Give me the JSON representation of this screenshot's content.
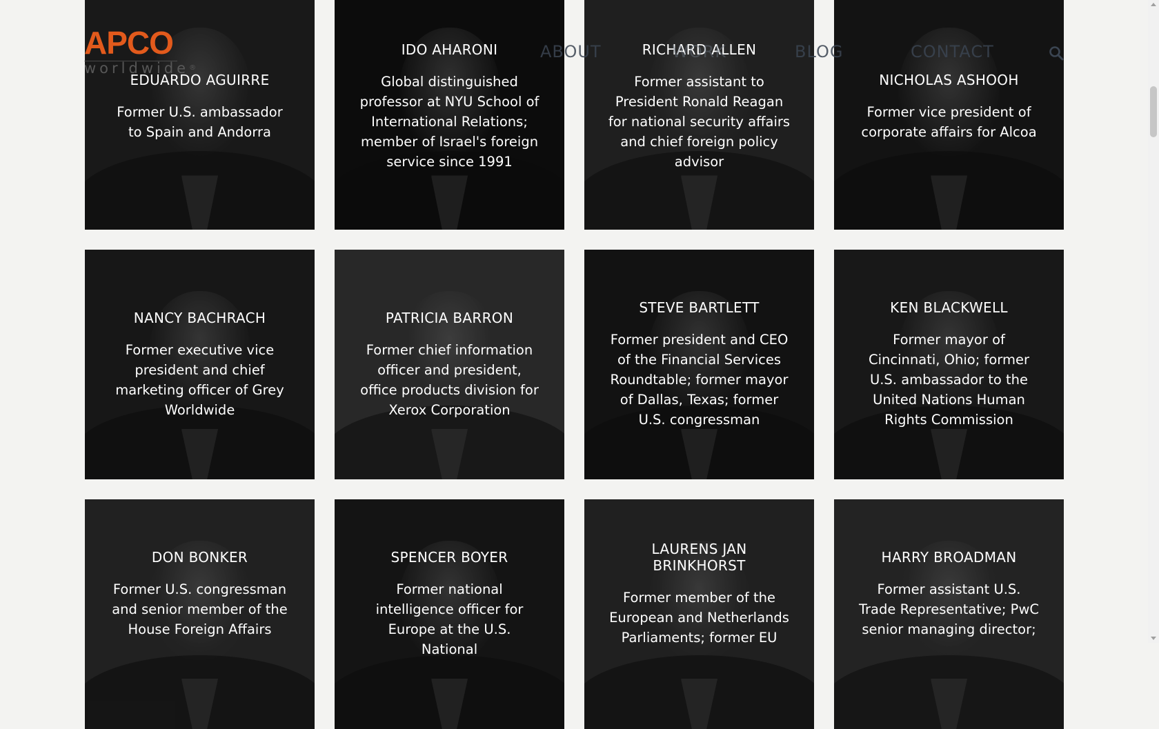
{
  "header": {
    "logo_text": "APCO",
    "logo_sub": "worldwide",
    "logo_reg": "®",
    "nav": [
      "ABOUT",
      "WORK",
      "RICHARD ALLEN",
      "BLOG",
      "CONTACT"
    ],
    "search_icon": "search-icon",
    "brand_color": "#e25a1c"
  },
  "people": [
    {
      "name": "EDUARDO AGUIRRE",
      "desc": "Former U.S. ambassador to Spain and Andorra"
    },
    {
      "name": "IDO AHARONI",
      "desc": "Global distinguished professor at NYU School of International Relations; member of Israel's foreign service since 1991"
    },
    {
      "name": "RICHARD ALLEN",
      "desc": "Former assistant to President Ronald Reagan for national security affairs and chief foreign policy advisor"
    },
    {
      "name": "NICHOLAS ASHOOH",
      "desc": "Former vice president of corporate affairs for Alcoa"
    },
    {
      "name": "NANCY BACHRACH",
      "desc": "Former executive vice president and chief marketing officer of Grey Worldwide"
    },
    {
      "name": "PATRICIA BARRON",
      "desc": "Former chief information officer and president, office products division for Xerox Corporation"
    },
    {
      "name": "STEVE BARTLETT",
      "desc": "Former president and CEO of the Financial Services Roundtable; former mayor of Dallas, Texas; former U.S. congressman"
    },
    {
      "name": "KEN BLACKWELL",
      "desc": "Former mayor of Cincinnati, Ohio; former U.S. ambassador to the United Nations Human Rights Commission"
    },
    {
      "name": "DON BONKER",
      "desc": "Former U.S. congressman and senior member of the House Foreign Affairs"
    },
    {
      "name": "SPENCER BOYER",
      "desc": "Former national intelligence officer for Europe at the U.S. National"
    },
    {
      "name": "LAURENS JAN BRINKHORST",
      "desc": "Former member of the European and Netherlands Parliaments; former EU"
    },
    {
      "name": "HARRY BROADMAN",
      "desc": "Former assistant U.S. Trade Representative; PwC senior managing director;"
    }
  ]
}
